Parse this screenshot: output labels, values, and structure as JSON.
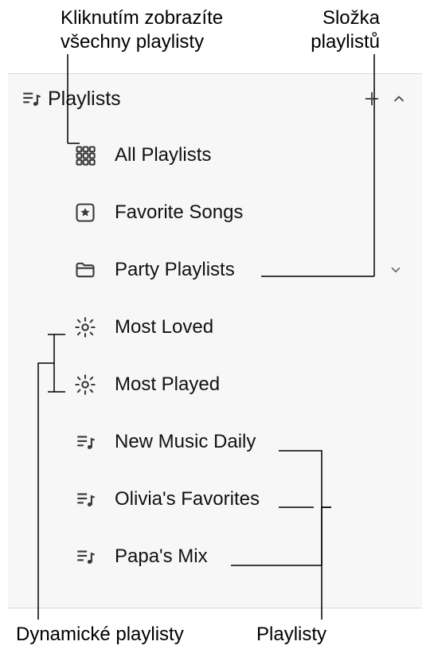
{
  "annotations": {
    "all_playlists_callout": "Kliknutím zobrazíte všechny playlisty",
    "folder_callout": "Složka playlistů",
    "smart_callout": "Dynamické playlisty",
    "playlists_callout": "Playlisty"
  },
  "sidebar": {
    "section_title": "Playlists",
    "items": {
      "all_playlists": "All Playlists",
      "favorite_songs": "Favorite Songs",
      "party_folder": "Party Playlists",
      "most_loved": "Most Loved",
      "most_played": "Most Played",
      "new_music_daily": "New Music Daily",
      "olivias_favorites": "Olivia's Favorites",
      "papas_mix": "Papa's Mix"
    }
  }
}
